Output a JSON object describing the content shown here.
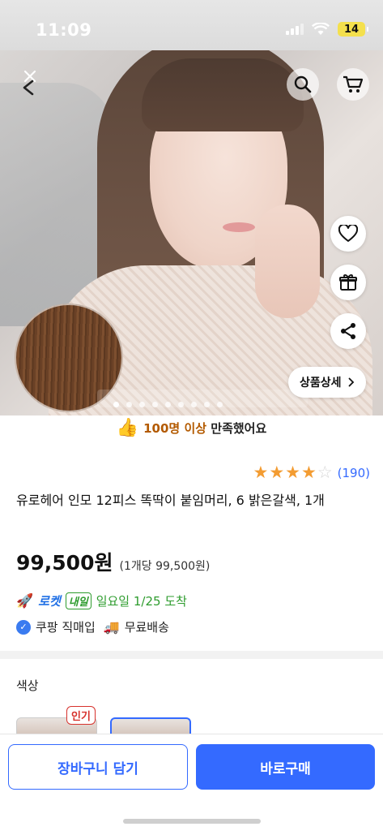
{
  "status_bar": {
    "time": "11:09",
    "battery": "14"
  },
  "hero": {
    "image_count": 9,
    "active_index": 0,
    "details_button": "상품상세"
  },
  "satisfaction": {
    "count_text": "100명 이상",
    "rest_text": " 만족했어요"
  },
  "rating": {
    "stars": 4,
    "max": 5,
    "review_count": "(190)"
  },
  "product": {
    "title": "유로헤어 인모 12피스 똑딱이 붙임머리, 6 밝은갈색, 1개",
    "price": "99,500원",
    "unit_price": "(1개당 99,500원)"
  },
  "delivery": {
    "rocket_label": "로켓",
    "tomorrow_badge": "내일",
    "arrival": "일요일 1/25 도착",
    "direct_purchase": "쿠팡 직매입",
    "free_shipping": "무료배송"
  },
  "options": {
    "label": "색상",
    "popular_badge": "인기"
  },
  "actions": {
    "add_to_cart": "장바구니 담기",
    "buy_now": "바로구매"
  },
  "colors": {
    "accent": "#346aff",
    "green": "#2e9c2e",
    "star": "#f39c32",
    "popular": "#d7322d"
  },
  "icons": [
    "back-icon",
    "search-icon",
    "cart-icon",
    "heart-icon",
    "gift-icon",
    "share-icon",
    "chevron-right-icon",
    "thumbs-up-icon",
    "rocket-icon",
    "check-icon",
    "truck-icon"
  ]
}
